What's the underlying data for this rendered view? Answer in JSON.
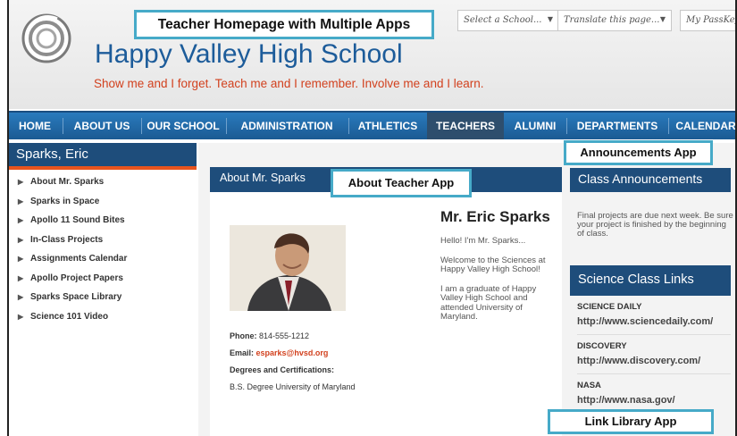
{
  "callouts": {
    "page": "Teacher Homepage with Multiple Apps",
    "about": "About Teacher App",
    "announcements": "Announcements App",
    "links": "Link Library App"
  },
  "header": {
    "school_name": "Happy Valley High School",
    "tagline": "Show me and I forget. Teach me and I remember. Involve me and I learn.",
    "select_school": "Select a School...",
    "translate": "Translate this page...",
    "passkeys": "My PassKeys",
    "caret": "▼"
  },
  "nav": {
    "items": [
      {
        "label": "HOME"
      },
      {
        "label": "ABOUT US"
      },
      {
        "label": "OUR SCHOOL"
      },
      {
        "label": "ADMINISTRATION"
      },
      {
        "label": "ATHLETICS"
      },
      {
        "label": "TEACHERS"
      },
      {
        "label": "ALUMNI"
      },
      {
        "label": "DEPARTMENTS"
      },
      {
        "label": "CALENDAR"
      }
    ],
    "active": "TEACHERS"
  },
  "sidebar": {
    "title": "Sparks, Eric",
    "items": [
      {
        "label": "About Mr. Sparks"
      },
      {
        "label": "Sparks in Space"
      },
      {
        "label": "Apollo 11 Sound Bites"
      },
      {
        "label": "In-Class Projects"
      },
      {
        "label": "Assignments Calendar"
      },
      {
        "label": "Apollo Project Papers"
      },
      {
        "label": "Sparks Space Library"
      },
      {
        "label": "Science 101 Video"
      }
    ]
  },
  "about": {
    "header": "About Mr. Sparks",
    "name": "Mr. Eric Sparks",
    "bio": [
      "Hello!  I'm Mr. Sparks...",
      "Welcome to the Sciences at Happy Valley High School!",
      "I am a graduate of Happy Valley High School and attended University of Maryland."
    ],
    "phone_label": "Phone:",
    "phone": "814-555-1212",
    "email_label": "Email:",
    "email": "esparks@hvsd.org",
    "degrees_label": "Degrees and Certifications:",
    "degree": "B.S. Degree University of Maryland"
  },
  "announcements": {
    "header": "Class Announcements",
    "text": "Final projects are due next week. Be sure your project is finished by the beginning of class."
  },
  "links": {
    "header": "Science Class Links",
    "items": [
      {
        "title": "SCIENCE DAILY",
        "url": "http://www.sciencedaily.com/"
      },
      {
        "title": "DISCOVERY",
        "url": "http://www.discovery.com/"
      },
      {
        "title": "NASA",
        "url": "http://www.nasa.gov/"
      }
    ]
  },
  "colors": {
    "brand_blue": "#1e4d7b",
    "nav_blue": "#2a7bbd",
    "accent_orange": "#e8541d",
    "callout_border": "#46aac8"
  }
}
